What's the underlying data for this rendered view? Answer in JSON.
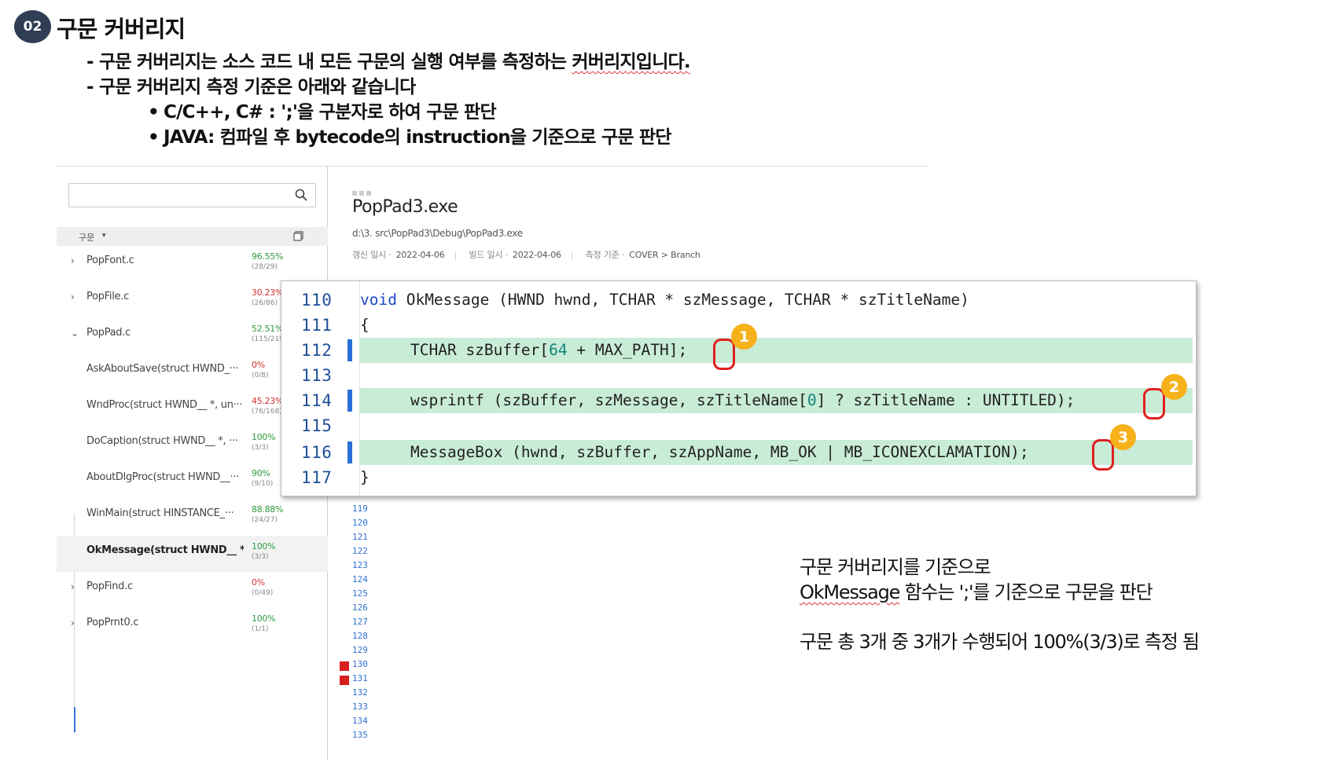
{
  "section": {
    "badge": "02",
    "title": "구문 커버리지"
  },
  "bullets": {
    "line1_pre": "- 구문 커버리지는 소스 코드 내 모든 구문의 실행 여부를 측정하는 ",
    "line1_wavy": "커버리지입니다.",
    "line2": "- 구문 커버리지 측정 기준은 아래와 같습니다",
    "sub1": "C/C++, C# : ';'을 구분자로 하여 구문 판단",
    "sub2": "JAVA: 컴파일 후 bytecode의 instruction을 기준으로 구문 판단",
    "dot": "•"
  },
  "sidebar": {
    "search_placeholder": "",
    "column_label": "구문",
    "caret": "▾",
    "items": [
      {
        "chevron": "›",
        "name": "PopFont.c",
        "pct": "96.55%",
        "frac": "(28/29)",
        "status": "green"
      },
      {
        "chevron": "›",
        "name": "PopFile.c",
        "pct": "30.23%",
        "frac": "(26/86)",
        "status": "red"
      },
      {
        "chevron": "⌄",
        "name": "PopPad.c",
        "pct": "52.51%",
        "frac": "(115/219)",
        "status": "green"
      },
      {
        "chevron": "",
        "name": "AskAboutSave(struct HWND_···",
        "pct": "0%",
        "frac": "(0/8)",
        "status": "red"
      },
      {
        "chevron": "",
        "name": "WndProc(struct HWND__ *, un···",
        "pct": "45.23%",
        "frac": "(76/168)",
        "status": "red"
      },
      {
        "chevron": "",
        "name": "DoCaption(struct HWND__ *, ···",
        "pct": "100%",
        "frac": "(3/3)",
        "status": "green"
      },
      {
        "chevron": "",
        "name": "AboutDlgProc(struct HWND__···",
        "pct": "90%",
        "frac": "(9/10)",
        "status": "green"
      },
      {
        "chevron": "",
        "name": "WinMain(struct HINSTANCE_···",
        "pct": "88.88%",
        "frac": "(24/27)",
        "status": "green"
      },
      {
        "chevron": "",
        "name": "OkMessage(struct HWND__ *, ···",
        "pct": "100%",
        "frac": "(3/3)",
        "status": "green"
      },
      {
        "chevron": "›",
        "name": "PopFind.c",
        "pct": "0%",
        "frac": "(0/49)",
        "status": "red"
      },
      {
        "chevron": "›",
        "name": "PopPrnt0.c",
        "pct": "100%",
        "frac": "(1/1)",
        "status": "green"
      }
    ]
  },
  "detail": {
    "title": "PopPad3.exe",
    "path": "d:\\3. src\\PopPad3\\Debug\\PopPad3.exe",
    "update_label": "갱신 일시 ·",
    "update_date": "2022-04-06",
    "build_label": "빌드 일시 ·",
    "build_date": "2022-04-06",
    "criteria_label": "측정 기준 ·",
    "criteria_value": "COVER > Branch"
  },
  "background_lines": [
    "119",
    "120",
    "121",
    "122",
    "123",
    "124",
    "125",
    "126",
    "127",
    "128",
    "129",
    "130",
    "131",
    "132",
    "133",
    "134",
    "135"
  ],
  "background_marked": [
    "130",
    "131"
  ],
  "code": {
    "lines": [
      {
        "num": "110",
        "covered": false,
        "indent": false
      },
      {
        "num": "111",
        "covered": false,
        "indent": false
      },
      {
        "num": "112",
        "covered": true,
        "indent": true
      },
      {
        "num": "113",
        "covered": false,
        "indent": false
      },
      {
        "num": "114",
        "covered": true,
        "indent": true
      },
      {
        "num": "115",
        "covered": false,
        "indent": false
      },
      {
        "num": "116",
        "covered": true,
        "indent": true
      },
      {
        "num": "117",
        "covered": false,
        "indent": false
      }
    ],
    "l110_kw": "void",
    "l110_rest": " OkMessage (HWND hwnd, TCHAR * szMessage, TCHAR * szTitleName)",
    "l111": "{",
    "l112_a": "TCHAR szBuffer[",
    "l112_num": "64",
    "l112_b": " + MAX_PATH]",
    "l112_semi": ";",
    "l114_a": "wsprintf (szBuffer, szMessage, szTitleName[",
    "l114_num": "0",
    "l114_b": "] ? szTitleName : UNTITLED)",
    "l114_semi": ";",
    "l116_a": "MessageBox (hwnd, szBuffer, szAppName, MB_OK | MB_ICONEXCLAMATION)",
    "l116_semi": ";",
    "l117": "}",
    "badges": [
      "1",
      "2",
      "3"
    ]
  },
  "explain": {
    "line1": "구문 커버리지를 기준으로",
    "line2_wavy": "OkMessage",
    "line2_rest": " 함수는 ';'를 기준으로 구문을 판단",
    "line3": "구문 총 3개 중 3개가 수행되어 100%(3/3)로 측정 됨"
  },
  "colors": {
    "badge_bg": "#2f3d55",
    "covered_bg": "#c9ecd6",
    "marker_blue": "#2a6fd6",
    "highlight_red": "#e02020",
    "step_badge": "#f7b21b",
    "pct_green": "#2e9a3e",
    "pct_red": "#d2312d"
  },
  "icons": {
    "search": "search-icon",
    "copy": "copy-icon"
  }
}
